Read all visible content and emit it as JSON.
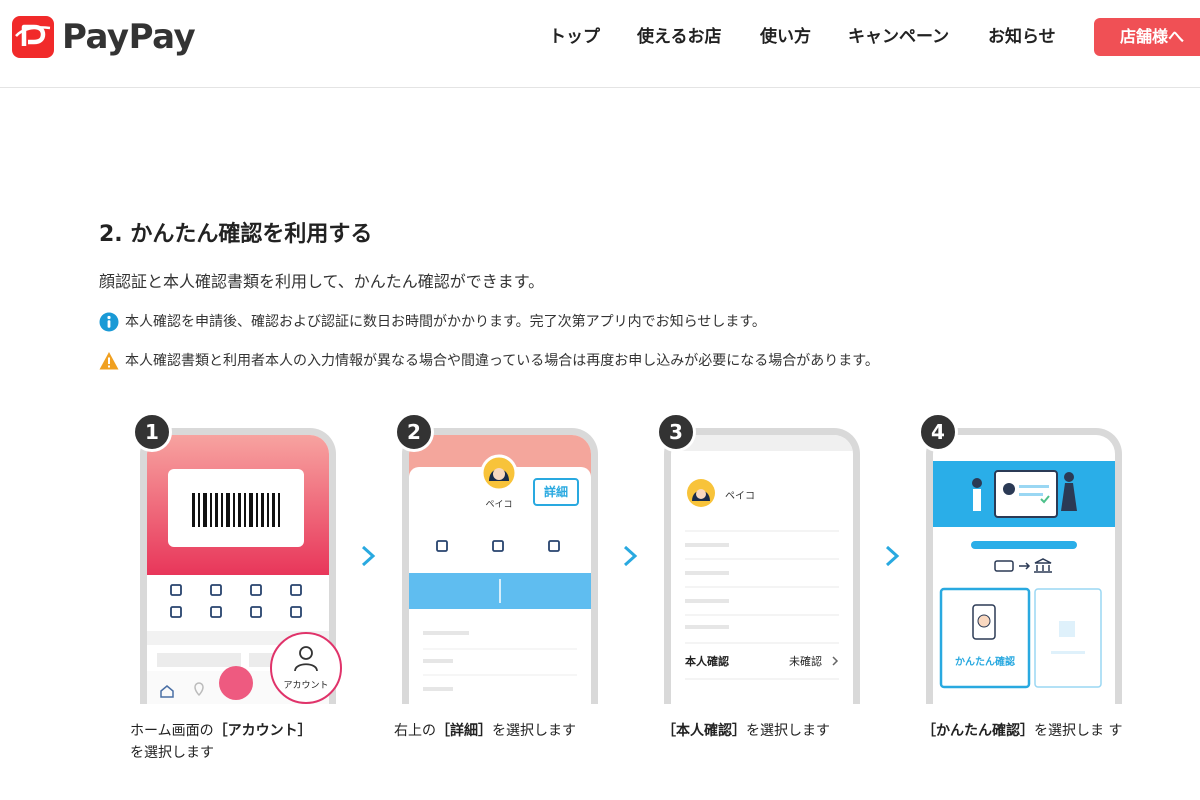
{
  "header": {
    "logo_text": "PayPay",
    "nav": [
      "トップ",
      "使えるお店",
      "使い方",
      "キャンペーン",
      "お知らせ"
    ],
    "cta_label": "店舗様へ"
  },
  "section": {
    "title": "2. かんたん確認を利用する",
    "lead": "顔認証と本人確認書類を利用して、かんたん確認ができます。",
    "info_note": "本人確認を申請後、確認および認証に数日お時間がかかります。完了次第アプリ内でお知らせします。",
    "warning_note": "本人確認書類と利用者本人の入力情報が異なる場合や間違っている場合は再度お申し込みが必要になる場合があります。"
  },
  "steps": [
    {
      "number": "1",
      "account_label": "アカウント",
      "caption_prefix": "ホーム画面の",
      "caption_bold": "［アカウント］",
      "caption_suffix": "を選択します"
    },
    {
      "number": "2",
      "profile_name": "ペイコ",
      "detail_label": "詳細",
      "caption_prefix": "右上の",
      "caption_bold": "［詳細］",
      "caption_suffix": "を選択します"
    },
    {
      "number": "3",
      "profile_name": "ペイコ",
      "row_label": "本人確認",
      "row_status": "未確認",
      "caption_prefix": "",
      "caption_bold": "［本人確認］",
      "caption_suffix": "を選択します"
    },
    {
      "number": "4",
      "option_label": "かんたん確認",
      "caption_prefix": "",
      "caption_bold": "［かんたん確認］",
      "caption_suffix": "を選択しま す"
    }
  ],
  "colors": {
    "brand_red": "#f12a2a",
    "cta": "#f05055",
    "accent_blue": "#29a9e0",
    "info_icon": "#1a9ad6",
    "warning_icon": "#f0a020"
  }
}
